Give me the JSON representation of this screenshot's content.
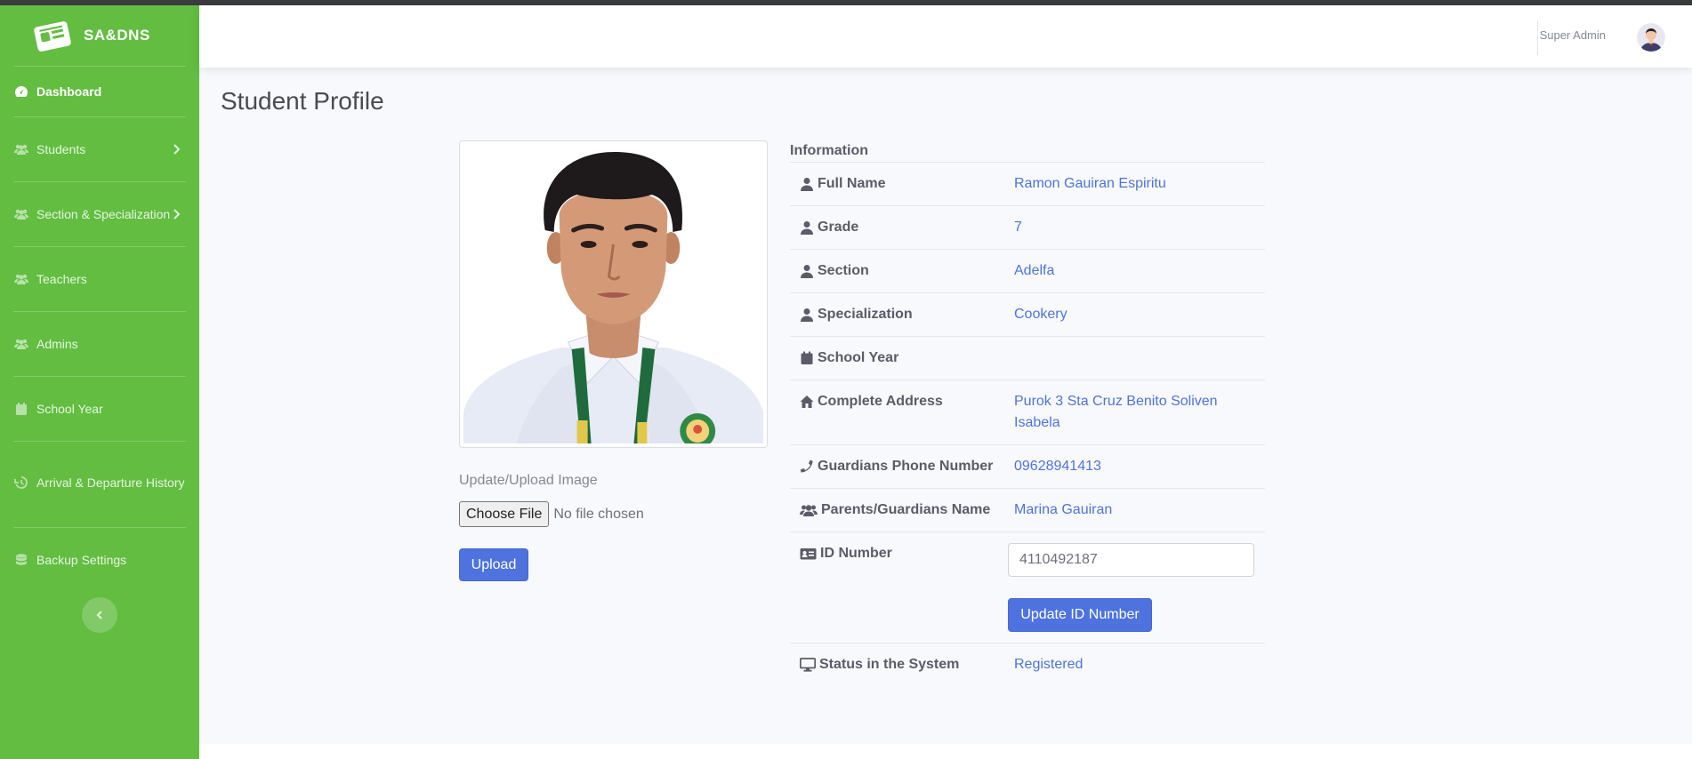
{
  "brand": {
    "name": "SA&DNS"
  },
  "sidebar": {
    "items": [
      {
        "label": "Dashboard",
        "icon": "tachometer-icon"
      },
      {
        "label": "Students",
        "icon": "users-icon"
      },
      {
        "label": "Section & Specialization",
        "icon": "users-icon"
      },
      {
        "label": "Teachers",
        "icon": "users-icon"
      },
      {
        "label": "Admins",
        "icon": "users-icon"
      },
      {
        "label": "School Year",
        "icon": "calendar-icon"
      },
      {
        "label": "Arrival & Departure History",
        "icon": "history-icon"
      },
      {
        "label": "Backup Settings",
        "icon": "database-icon"
      }
    ]
  },
  "topbar": {
    "user_name": "Super Admin"
  },
  "page": {
    "title": "Student Profile"
  },
  "upload": {
    "label": "Update/Upload Image",
    "choose_file": "Choose File",
    "no_file": "No file chosen",
    "button": "Upload"
  },
  "info": {
    "heading": "Information",
    "full_name": {
      "label": "Full Name",
      "value": "Ramon Gauiran Espiritu"
    },
    "grade": {
      "label": "Grade",
      "value": "7"
    },
    "section": {
      "label": "Section",
      "value": "Adelfa"
    },
    "specialization": {
      "label": "Specialization",
      "value": "Cookery"
    },
    "school_year": {
      "label": "School Year",
      "value": ""
    },
    "address": {
      "label": "Complete Address",
      "value": "Purok 3 Sta Cruz Benito Soliven Isabela"
    },
    "guardian_phone": {
      "label": "Guardians Phone Number",
      "value": "09628941413"
    },
    "guardian_name": {
      "label": "Parents/Guardians Name",
      "value": "Marina Gauiran"
    },
    "id_number": {
      "label": "ID Number",
      "value": "4110492187",
      "button": "Update ID Number"
    },
    "status": {
      "label": "Status in the System",
      "value": "Registered"
    }
  },
  "colors": {
    "sidebar": "#62bd41",
    "primary": "#4e73df",
    "text": "#5a5c69"
  }
}
